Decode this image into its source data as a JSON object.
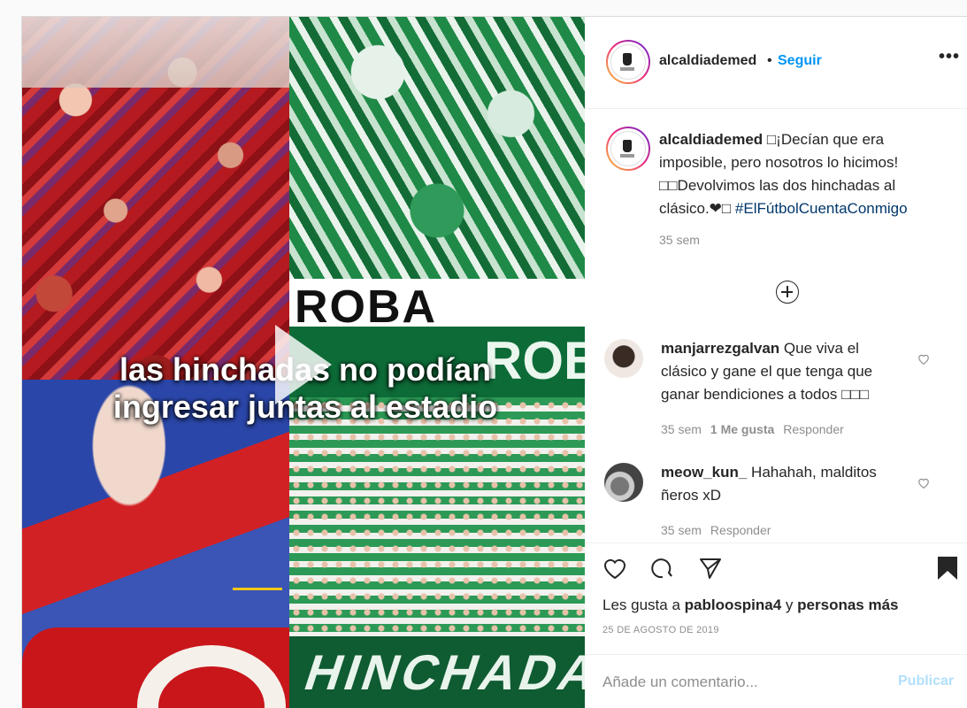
{
  "media": {
    "overlay_line1": "las hinchadas no podían",
    "overlay_line2": "ingresar juntas al estadio",
    "banner_text_top": "ROBA",
    "banner_text_mid": "ROBI",
    "banner_text_bottom": "HINCHADA"
  },
  "header": {
    "username": "alcaldiademed",
    "separator": "•",
    "follow_label": "Seguir",
    "more_icon": "•••"
  },
  "caption": {
    "username": "alcaldiademed",
    "text": " □¡Decían que era imposible, pero nosotros lo hicimos! □□Devolvimos las dos hinchadas al clásico.❤□ ",
    "hashtag": "#ElFútbolCuentaConmigo",
    "time": "35 sem"
  },
  "comments": [
    {
      "username": "manjarrezgalvan",
      "text": " Que viva el clásico y gane el que tenga que ganar bendiciones a todos □□□",
      "time": "35 sem",
      "likes": "1 Me gusta",
      "reply": "Responder"
    },
    {
      "username": "meow_kun_",
      "text": " Hahahah, malditos ñeros xD",
      "time": "35 sem",
      "reply": "Responder"
    }
  ],
  "actions": {
    "likes_prefix": "Les gusta a ",
    "likes_user": "pabloospina4",
    "likes_middle": " y ",
    "likes_suffix": "personas más",
    "date": "25 DE AGOSTO DE 2019"
  },
  "add_comment": {
    "placeholder": "Añade un comentario...",
    "publish_label": "Publicar"
  },
  "colors": {
    "accent": "#0095f6",
    "hashtag": "#00376b",
    "muted": "#8e8e8e",
    "publish_disabled": "#b2dffc"
  },
  "icons": [
    "heart-icon",
    "comment-icon",
    "share-icon",
    "bookmark-icon",
    "more-icon",
    "add-circle-icon",
    "play-icon"
  ]
}
